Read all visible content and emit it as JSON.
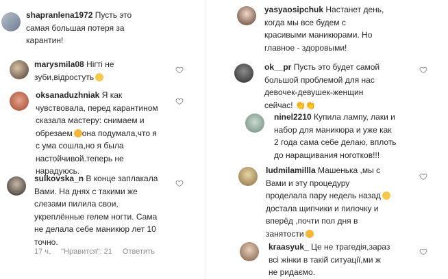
{
  "left": {
    "comments": [
      {
        "username": "shapranlena1972",
        "lines": [
          "Пусть это",
          "самая большая потеря за",
          "карантин!"
        ]
      },
      {
        "username": "marysmila08",
        "lines": [
          "Нігті не",
          "зуби,відростуть"
        ]
      },
      {
        "username": "oksanaduzhniak",
        "lines": [
          "Я как",
          "чувствовала, перед карантином",
          "сказала мастеру: снимаем и",
          "обрезаем",
          "она подумала,что я",
          "с ума сошла,но я была",
          "настойчивой.теперь не",
          "нарадуюсь."
        ]
      },
      {
        "username": "sulkovska_n",
        "lines": [
          "В конце заплакала",
          "Вами. На днях с такими же",
          "слезами пилила свои,",
          "укреплённые гелем ногти. Сама",
          "не делала себе маникюр лет 10",
          "точно."
        ]
      }
    ],
    "meta": {
      "time": "17 ч.",
      "likes": "\"Нравится\": 21",
      "reply": "Ответить"
    }
  },
  "right": {
    "comments": [
      {
        "username": "yasyaosipchuk",
        "lines": [
          "Настанет день,",
          "когда мы все будем с",
          "красивыми маникюрами. Но",
          "главное - здоровыми!"
        ]
      },
      {
        "username": "ok__pr",
        "lines": [
          "Пусть это будет самой",
          "большой проблемой для нас",
          "девочек-девушек-женщин",
          "сейчас! 👏👏"
        ]
      },
      {
        "username": "ninel2210",
        "lines": [
          "Купила лампу, лаки и",
          "набор для маникюра и уже как",
          "2 года сама себе делаю, вплоть",
          "до наращивания ноготков!!!"
        ]
      },
      {
        "username": "ludmilamillla",
        "lines": [
          "Машенька ,мы с",
          "Вами и эту процедуру",
          "проделала пару недель назад",
          "достала щипчики и пилочку и",
          "вперёд ,почти пол дня в",
          "занятости"
        ]
      },
      {
        "username": "kraasyuk_",
        "lines": [
          "Це не трагедія,зараз",
          "всі жінки в такій ситуації,ми ж",
          "не ридаємо."
        ]
      }
    ]
  },
  "colors": {
    "text": "#262626",
    "muted": "#8e8e8e",
    "emoji": "#f7c948"
  },
  "icons": {
    "like": "heart-icon",
    "smile": "smiling-face-emoji",
    "grin": "grinning-face-emoji",
    "clap": "clapping-hands-emoji"
  }
}
